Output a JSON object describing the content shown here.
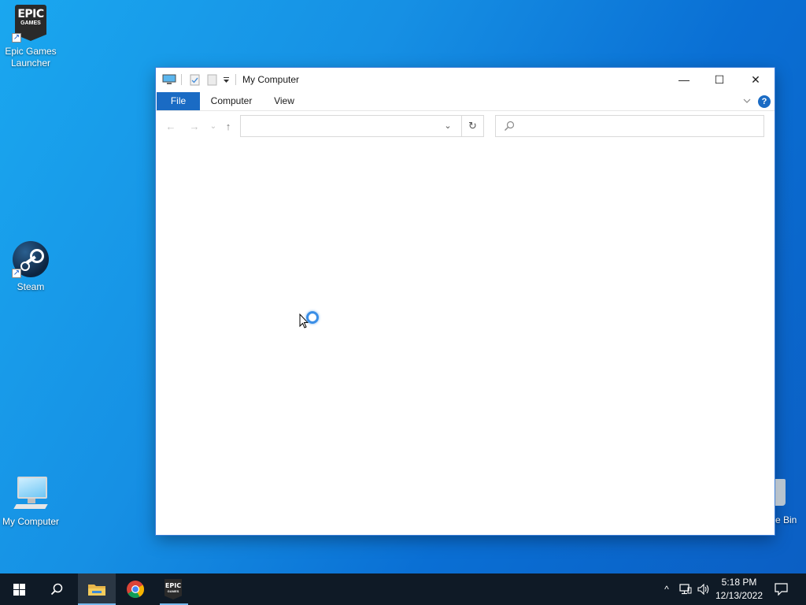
{
  "desktop": {
    "icons": [
      {
        "label_line1": "Epic Games",
        "label_line2": "Launcher"
      },
      {
        "label_line1": "Steam"
      },
      {
        "label_line1": "My Computer"
      },
      {
        "label_line1": "e Bin"
      }
    ],
    "epic_logo": {
      "line1": "EPIC",
      "line2": "GAMES"
    }
  },
  "window": {
    "title": "My Computer",
    "controls": {
      "minimize": "—",
      "maximize": "☐",
      "close": "✕"
    },
    "ribbon_tabs": [
      "File",
      "Computer",
      "View"
    ],
    "help": "?",
    "nav": {
      "back": "←",
      "forward": "→",
      "recent": "⌄",
      "up": "↑"
    },
    "address": {
      "value": "",
      "dropdown": "⌄",
      "refresh": "↻"
    },
    "search": {
      "placeholder": "",
      "icon": "⌕"
    }
  },
  "taskbar": {
    "apps": [
      "start-button",
      "search-button",
      "file-explorer",
      "chrome",
      "epic-games"
    ],
    "active_app": "file-explorer",
    "tray": {
      "chevron": "^",
      "network": "network-icon",
      "volume": "volume-icon"
    },
    "clock": {
      "time": "5:18 PM",
      "date": "12/13/2022"
    }
  },
  "colors": {
    "accent": "#1a6bc4",
    "desktop_blue": "#1690e4",
    "taskbar": "#0f1a26"
  }
}
